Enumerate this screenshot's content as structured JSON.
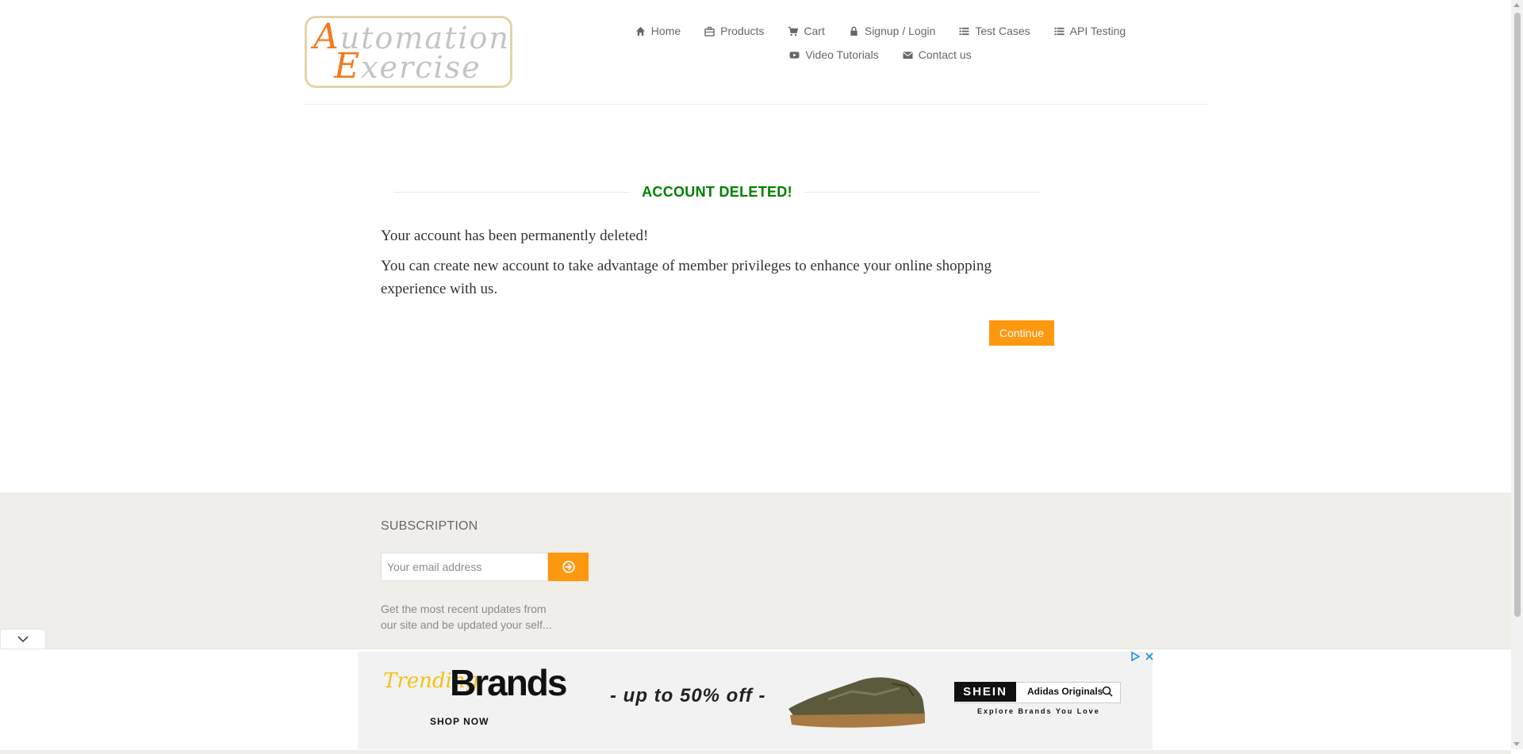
{
  "header": {
    "logo": {
      "line1": "Automation",
      "line2": "Exercise"
    },
    "nav": [
      {
        "label": "Home",
        "icon": "home-icon"
      },
      {
        "label": "Products",
        "icon": "briefcase-icon"
      },
      {
        "label": "Cart",
        "icon": "cart-icon"
      },
      {
        "label": "Signup / Login",
        "icon": "lock-icon"
      },
      {
        "label": "Test Cases",
        "icon": "list-icon"
      },
      {
        "label": "API Testing",
        "icon": "list-icon"
      },
      {
        "label": "Video Tutorials",
        "icon": "youtube-icon"
      },
      {
        "label": "Contact us",
        "icon": "envelope-icon"
      }
    ]
  },
  "main": {
    "title": "ACCOUNT DELETED!",
    "message1": "Your account has been permanently deleted!",
    "message2": "You can create new account to take advantage of member privileges to enhance your online shopping experience with us.",
    "continue_label": "Continue"
  },
  "footer": {
    "subscription_title": "SUBSCRIPTION",
    "email_placeholder": "Your email address",
    "description": "Get the most recent updates from our site and be updated your self..."
  },
  "ad": {
    "trending": "Trending",
    "brands": "Brands",
    "shop_now": "SHOP NOW",
    "offer": "- up to 50% off -",
    "shein": "SHEIN",
    "adidas": "Adidas Originals",
    "explore": "Explore Brands You Love"
  },
  "colors": {
    "accent": "#fe980f",
    "title_green": "#008000",
    "footer_bg": "#efeee8",
    "text": "#696763"
  }
}
